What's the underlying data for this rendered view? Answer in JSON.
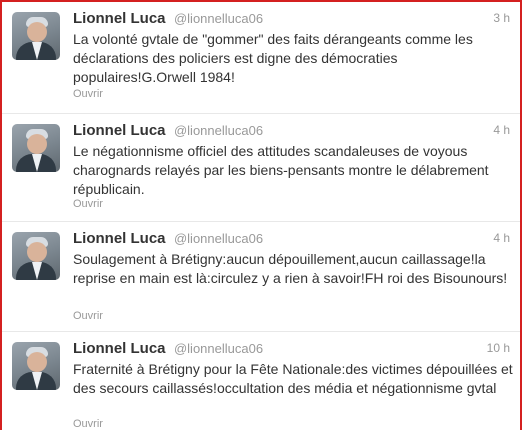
{
  "tweets": [
    {
      "name": "Lionnel Luca",
      "handle": "@lionnelluca06",
      "time": "3 h",
      "text": "La volonté gvtale de \"gommer\" des faits dérangeants comme les déclarations des policiers est digne des démocraties populaires!G.Orwell 1984!",
      "action": "Ouvrir"
    },
    {
      "name": "Lionnel Luca",
      "handle": "@lionnelluca06",
      "time": "4 h",
      "text": "Le négationnisme officiel des attitudes scandaleuses de voyous charognards relayés par les biens-pensants montre le délabrement républicain.",
      "action": "Ouvrir"
    },
    {
      "name": "Lionnel Luca",
      "handle": "@lionnelluca06",
      "time": "4 h",
      "text": "Soulagement à Brétigny:aucun dépouillement,aucun caillassage!la reprise en main est là:circulez y a rien à savoir!FH roi des Bisounours!",
      "action": "Ouvrir"
    },
    {
      "name": "Lionnel Luca",
      "handle": "@lionnelluca06",
      "time": "10 h",
      "text": "Fraternité à Brétigny pour la Fête Nationale:des victimes dépouillées et des secours caillassés!occultation des média et négationnisme gvtal",
      "action": "Ouvrir"
    }
  ],
  "colors": {
    "frame_border": "#d42020",
    "name": "#333333",
    "meta": "#999999",
    "divider": "#e8e8e8"
  },
  "icons": {
    "avatar": "profile-photo"
  }
}
